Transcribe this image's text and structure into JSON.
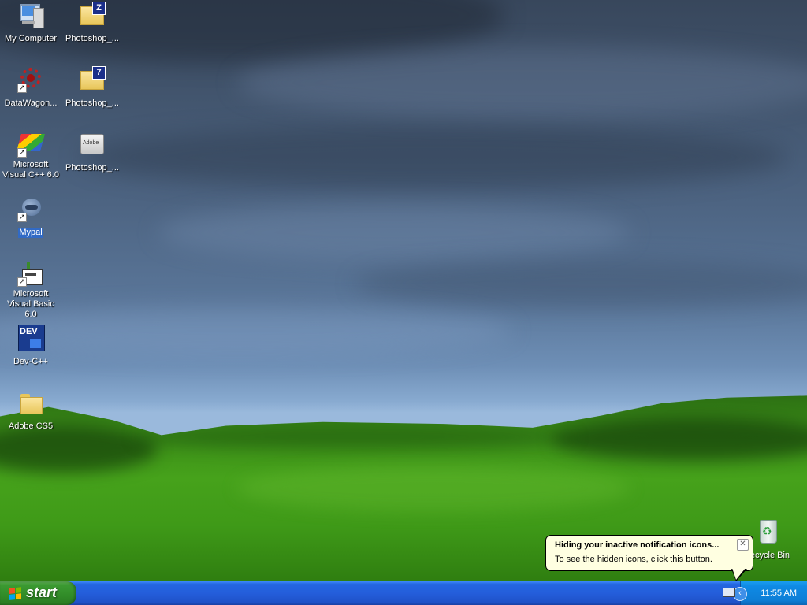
{
  "desktop_icons": [
    {
      "label": "My Computer",
      "icon": "my-computer-icon"
    },
    {
      "label": "DataWagon...",
      "icon": "datawagon-icon"
    },
    {
      "label": "Microsoft Visual C++ 6.0",
      "icon": "visual-cpp-icon"
    },
    {
      "label": "Mypal",
      "icon": "mypal-icon"
    },
    {
      "label": "Microsoft Visual Basic 6.0",
      "icon": "visual-basic-icon"
    },
    {
      "label": "Dev-C++",
      "icon": "dev-cpp-icon"
    },
    {
      "label": "Adobe CS5",
      "icon": "folder-icon"
    },
    {
      "label": "Photoshop_...",
      "icon": "zip-folder-icon"
    },
    {
      "label": "Photoshop_...",
      "icon": "7z-folder-icon"
    },
    {
      "label": "Photoshop_...",
      "icon": "adobe-box-icon"
    },
    {
      "label": "Recycle Bin",
      "icon": "recycle-bin-icon"
    }
  ],
  "dev_cpp_badge": "DEV",
  "adobe_badge": "Adobe",
  "taskbar": {
    "start_label": "start",
    "clock": "11:55 AM"
  },
  "balloon": {
    "title": "Hiding your inactive notification icons...",
    "text": "To see the hidden icons, click this button."
  },
  "colors": {
    "taskbar_blue": "#245edb",
    "start_green": "#318c28",
    "selection": "#316ac5",
    "balloon_bg": "#ffffe1"
  }
}
